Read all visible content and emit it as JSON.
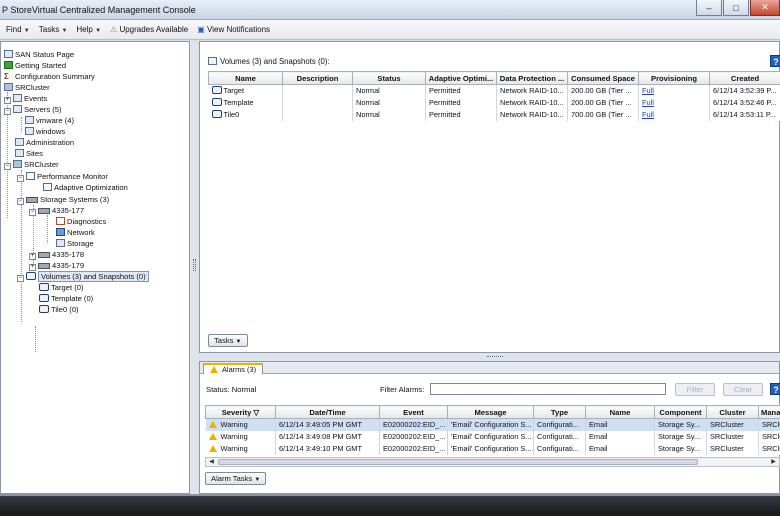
{
  "window": {
    "title": "P StoreVirtual Centralized Management Console",
    "minimize": "–",
    "maximize": "□",
    "close": "✕"
  },
  "menubar": {
    "items": [
      "Find",
      "Tasks",
      "Help"
    ],
    "upgrades": "Upgrades Available",
    "notifications": "View Notifications"
  },
  "tree": {
    "san_status": "SAN Status Page",
    "getting_started": "Getting Started",
    "config_summary": "Configuration Summary",
    "srcluster_root": "SRCluster",
    "events": "Events",
    "servers": "Servers (5)",
    "server_vmware": "vmware (4)",
    "server_windows": "windows",
    "administration": "Administration",
    "sites": "Sites",
    "srcluster": "SRCluster",
    "performance_monitor": "Performance Monitor",
    "adaptive_optimization": "Adaptive Optimization",
    "storage_systems": "Storage Systems (3)",
    "sys_177": "4335-177",
    "diagnostics": "Diagnostics",
    "network": "Network",
    "storage": "Storage",
    "sys_178": "4335-178",
    "sys_179": "4335-179",
    "volumes": "Volumes (3) and Snapshots (0)",
    "vol_target": "Target (0)",
    "vol_template": "Template (0)",
    "vol_tile0": "Tile0 (0)"
  },
  "volumes_panel": {
    "heading": "Volumes (3) and Snapshots (0):",
    "help": "?",
    "columns": [
      "Name",
      "Description",
      "Status",
      "Adaptive Optimi...",
      "Data Protection ...",
      "Consumed Space",
      "Provisioning",
      "Created"
    ],
    "rows": [
      {
        "name": "Target",
        "description": "",
        "status": "Normal",
        "adaptive": "Permitted",
        "protection": "Network RAID-10...",
        "consumed": "200.00 GB (Tier ...",
        "provisioning": "Full",
        "created": "6/12/14 3:52:39 P..."
      },
      {
        "name": "Template",
        "description": "",
        "status": "Normal",
        "adaptive": "Permitted",
        "protection": "Network RAID-10...",
        "consumed": "200.00 GB (Tier ...",
        "provisioning": "Full",
        "created": "6/12/14 3:52:46 P..."
      },
      {
        "name": "Tile0",
        "description": "",
        "status": "Normal",
        "adaptive": "Permitted",
        "protection": "Network RAID-10...",
        "consumed": "700.00 GB (Tier ...",
        "provisioning": "Full",
        "created": "6/12/14 3:53:11 P..."
      }
    ],
    "tasks_button": "Tasks"
  },
  "alarms_panel": {
    "tab": "Alarms (3)",
    "status_label": "Status:",
    "status_value": "Normal",
    "filter_label": "Filter Alarms:",
    "filter_value": "",
    "filter_button": "Filter",
    "clear_button": "Clear",
    "help": "?",
    "columns": [
      "Severity",
      "Date/Time",
      "Event",
      "Message",
      "Type",
      "Name",
      "Component",
      "Cluster",
      "Mana"
    ],
    "rows": [
      {
        "severity": "Warning",
        "datetime": "6/12/14 3:49:05 PM GMT",
        "event": "E02000202:EID_...",
        "message": "'Email' Configuration S...",
        "type": "Configurati...",
        "name": "Email",
        "component": "Storage Sy...",
        "cluster": "SRCluster",
        "mana": "SRClu"
      },
      {
        "severity": "Warning",
        "datetime": "6/12/14 3:49:08 PM GMT",
        "event": "E02000202:EID_...",
        "message": "'Email' Configuration S...",
        "type": "Configurati...",
        "name": "Email",
        "component": "Storage Sy...",
        "cluster": "SRCluster",
        "mana": "SRClu"
      },
      {
        "severity": "Warning",
        "datetime": "6/12/14 3:49:10 PM GMT",
        "event": "E02000202:EID_...",
        "message": "'Email' Configuration S...",
        "type": "Configurati...",
        "name": "Email",
        "component": "Storage Sy...",
        "cluster": "SRCluster",
        "mana": "SRClu"
      }
    ],
    "alarm_tasks_button": "Alarm Tasks"
  },
  "icons": {
    "san_status": "san-status-icon",
    "getting_started": "getting-started-icon",
    "volume": "volume-icon",
    "warning": "warning-icon",
    "sort": "sort-descending-icon"
  },
  "colors": {
    "accent": "#1b5fbf",
    "warning": "#e8b400",
    "selection": "#cfe0f5",
    "link": "#1a40c0"
  }
}
